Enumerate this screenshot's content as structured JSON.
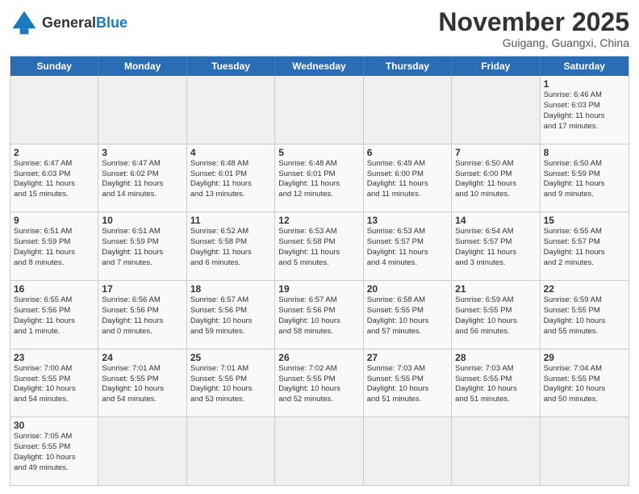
{
  "header": {
    "logo_general": "General",
    "logo_blue": "Blue",
    "month_title": "November 2025",
    "location": "Guigang, Guangxi, China"
  },
  "day_headers": [
    "Sunday",
    "Monday",
    "Tuesday",
    "Wednesday",
    "Thursday",
    "Friday",
    "Saturday"
  ],
  "weeks": [
    {
      "days": [
        {
          "num": "",
          "info": ""
        },
        {
          "num": "",
          "info": ""
        },
        {
          "num": "",
          "info": ""
        },
        {
          "num": "",
          "info": ""
        },
        {
          "num": "",
          "info": ""
        },
        {
          "num": "",
          "info": ""
        },
        {
          "num": "1",
          "info": "Sunrise: 6:46 AM\nSunset: 6:03 PM\nDaylight: 11 hours\nand 17 minutes."
        }
      ]
    },
    {
      "days": [
        {
          "num": "2",
          "info": "Sunrise: 6:47 AM\nSunset: 6:03 PM\nDaylight: 11 hours\nand 15 minutes."
        },
        {
          "num": "3",
          "info": "Sunrise: 6:47 AM\nSunset: 6:02 PM\nDaylight: 11 hours\nand 14 minutes."
        },
        {
          "num": "4",
          "info": "Sunrise: 6:48 AM\nSunset: 6:01 PM\nDaylight: 11 hours\nand 13 minutes."
        },
        {
          "num": "5",
          "info": "Sunrise: 6:48 AM\nSunset: 6:01 PM\nDaylight: 11 hours\nand 12 minutes."
        },
        {
          "num": "6",
          "info": "Sunrise: 6:49 AM\nSunset: 6:00 PM\nDaylight: 11 hours\nand 11 minutes."
        },
        {
          "num": "7",
          "info": "Sunrise: 6:50 AM\nSunset: 6:00 PM\nDaylight: 11 hours\nand 10 minutes."
        },
        {
          "num": "8",
          "info": "Sunrise: 6:50 AM\nSunset: 5:59 PM\nDaylight: 11 hours\nand 9 minutes."
        }
      ]
    },
    {
      "days": [
        {
          "num": "9",
          "info": "Sunrise: 6:51 AM\nSunset: 5:59 PM\nDaylight: 11 hours\nand 8 minutes."
        },
        {
          "num": "10",
          "info": "Sunrise: 6:51 AM\nSunset: 5:59 PM\nDaylight: 11 hours\nand 7 minutes."
        },
        {
          "num": "11",
          "info": "Sunrise: 6:52 AM\nSunset: 5:58 PM\nDaylight: 11 hours\nand 6 minutes."
        },
        {
          "num": "12",
          "info": "Sunrise: 6:53 AM\nSunset: 5:58 PM\nDaylight: 11 hours\nand 5 minutes."
        },
        {
          "num": "13",
          "info": "Sunrise: 6:53 AM\nSunset: 5:57 PM\nDaylight: 11 hours\nand 4 minutes."
        },
        {
          "num": "14",
          "info": "Sunrise: 6:54 AM\nSunset: 5:57 PM\nDaylight: 11 hours\nand 3 minutes."
        },
        {
          "num": "15",
          "info": "Sunrise: 6:55 AM\nSunset: 5:57 PM\nDaylight: 11 hours\nand 2 minutes."
        }
      ]
    },
    {
      "days": [
        {
          "num": "16",
          "info": "Sunrise: 6:55 AM\nSunset: 5:56 PM\nDaylight: 11 hours\nand 1 minute."
        },
        {
          "num": "17",
          "info": "Sunrise: 6:56 AM\nSunset: 5:56 PM\nDaylight: 11 hours\nand 0 minutes."
        },
        {
          "num": "18",
          "info": "Sunrise: 6:57 AM\nSunset: 5:56 PM\nDaylight: 10 hours\nand 59 minutes."
        },
        {
          "num": "19",
          "info": "Sunrise: 6:57 AM\nSunset: 5:56 PM\nDaylight: 10 hours\nand 58 minutes."
        },
        {
          "num": "20",
          "info": "Sunrise: 6:58 AM\nSunset: 5:55 PM\nDaylight: 10 hours\nand 57 minutes."
        },
        {
          "num": "21",
          "info": "Sunrise: 6:59 AM\nSunset: 5:55 PM\nDaylight: 10 hours\nand 56 minutes."
        },
        {
          "num": "22",
          "info": "Sunrise: 6:59 AM\nSunset: 5:55 PM\nDaylight: 10 hours\nand 55 minutes."
        }
      ]
    },
    {
      "days": [
        {
          "num": "23",
          "info": "Sunrise: 7:00 AM\nSunset: 5:55 PM\nDaylight: 10 hours\nand 54 minutes."
        },
        {
          "num": "24",
          "info": "Sunrise: 7:01 AM\nSunset: 5:55 PM\nDaylight: 10 hours\nand 54 minutes."
        },
        {
          "num": "25",
          "info": "Sunrise: 7:01 AM\nSunset: 5:55 PM\nDaylight: 10 hours\nand 53 minutes."
        },
        {
          "num": "26",
          "info": "Sunrise: 7:02 AM\nSunset: 5:55 PM\nDaylight: 10 hours\nand 52 minutes."
        },
        {
          "num": "27",
          "info": "Sunrise: 7:03 AM\nSunset: 5:55 PM\nDaylight: 10 hours\nand 51 minutes."
        },
        {
          "num": "28",
          "info": "Sunrise: 7:03 AM\nSunset: 5:55 PM\nDaylight: 10 hours\nand 51 minutes."
        },
        {
          "num": "29",
          "info": "Sunrise: 7:04 AM\nSunset: 5:55 PM\nDaylight: 10 hours\nand 50 minutes."
        }
      ]
    },
    {
      "days": [
        {
          "num": "30",
          "info": "Sunrise: 7:05 AM\nSunset: 5:55 PM\nDaylight: 10 hours\nand 49 minutes."
        },
        {
          "num": "",
          "info": ""
        },
        {
          "num": "",
          "info": ""
        },
        {
          "num": "",
          "info": ""
        },
        {
          "num": "",
          "info": ""
        },
        {
          "num": "",
          "info": ""
        },
        {
          "num": "",
          "info": ""
        }
      ]
    }
  ]
}
